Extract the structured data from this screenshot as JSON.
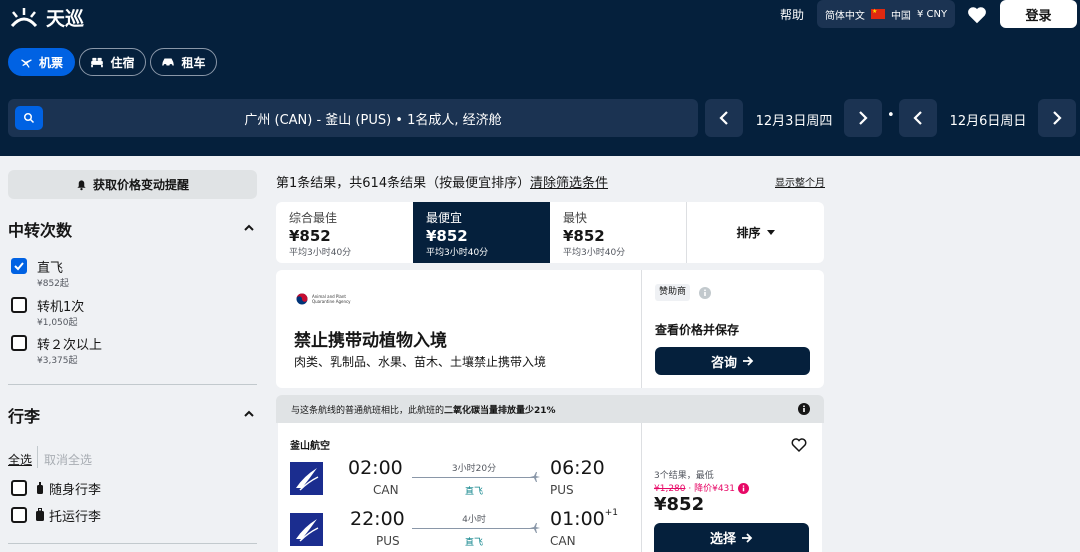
{
  "brand": {
    "name": "天巡"
  },
  "header": {
    "help": "帮助",
    "locale": {
      "language": "简体中文",
      "country": "中国",
      "currency": "¥ CNY"
    },
    "login": "登录"
  },
  "tabs": [
    {
      "label": "机票",
      "icon": "plane-icon",
      "active": true
    },
    {
      "label": "住宿",
      "icon": "bed-icon",
      "active": false
    },
    {
      "label": "租车",
      "icon": "car-icon",
      "active": false
    }
  ],
  "search": {
    "summary": "广州 (CAN) - 釜山 (PUS) • 1名成人, 经济舱",
    "depart_date": "12月3日周四",
    "return_date": "12月6日周日",
    "date_separator": "•"
  },
  "sidebar": {
    "alert_button": "获取价格变动提醒",
    "stops": {
      "title": "中转次数",
      "options": [
        {
          "label": "直飞",
          "sub": "¥852起",
          "checked": true
        },
        {
          "label": "转机1次",
          "sub": "¥1,050起",
          "checked": false
        },
        {
          "label": "转２次以上",
          "sub": "¥3,375起",
          "checked": false
        }
      ]
    },
    "baggage": {
      "title": "行李",
      "select_all": "全选",
      "deselect_all": "取消全选",
      "options": [
        {
          "label": "随身行李",
          "icon": "carry-on-bag-icon",
          "checked": false
        },
        {
          "label": "托运行李",
          "icon": "checked-bag-icon",
          "checked": false
        }
      ]
    }
  },
  "results": {
    "summary": "第1条结果，共614条结果（按最便宜排序）",
    "clear_filters": "清除筛选条件",
    "show_month": "显示整个月",
    "sort_tabs": [
      {
        "label": "综合最佳",
        "price": "¥852",
        "sub": "平均3小时40分",
        "active": false
      },
      {
        "label": "最便宜",
        "price": "¥852",
        "sub": "平均3小时40分",
        "active": true
      },
      {
        "label": "最快",
        "price": "¥852",
        "sub": "平均3小时40分",
        "active": false
      }
    ],
    "sort_dropdown": "排序"
  },
  "ad": {
    "logo_text_line1": "Animal and Plant",
    "logo_text_line2": "Quarantine Agency",
    "title": "禁止携带动植物入境",
    "description": "肉类、乳制品、水果、苗木、土壤禁止携带入境",
    "sponsor": "赞助商",
    "cta_label": "查看价格并保存",
    "cta_button": "咨询"
  },
  "eco": {
    "prefix": "与这条航线的普通航班相比，此航班的",
    "highlight": "二氧化碳当量排放量少21%"
  },
  "flight": {
    "airline": "釜山航空",
    "outbound": {
      "depart_time": "02:00",
      "depart_code": "CAN",
      "duration": "3小时20分",
      "stops": "直飞",
      "arrive_time": "06:20",
      "arrive_code": "PUS",
      "day_offset": ""
    },
    "inbound": {
      "depart_time": "22:00",
      "depart_code": "PUS",
      "duration": "4小时",
      "stops": "直飞",
      "arrive_time": "01:00",
      "arrive_code": "CAN",
      "day_offset": "+1"
    },
    "results_count": "3个结果，最低",
    "old_price": "¥1,280",
    "discount": "· 降价¥431",
    "price": "¥852",
    "select_button": "选择"
  },
  "colors": {
    "navy": "#05203c",
    "blue": "#0062e3",
    "teal": "#0c838a",
    "pink": "#e70866"
  }
}
